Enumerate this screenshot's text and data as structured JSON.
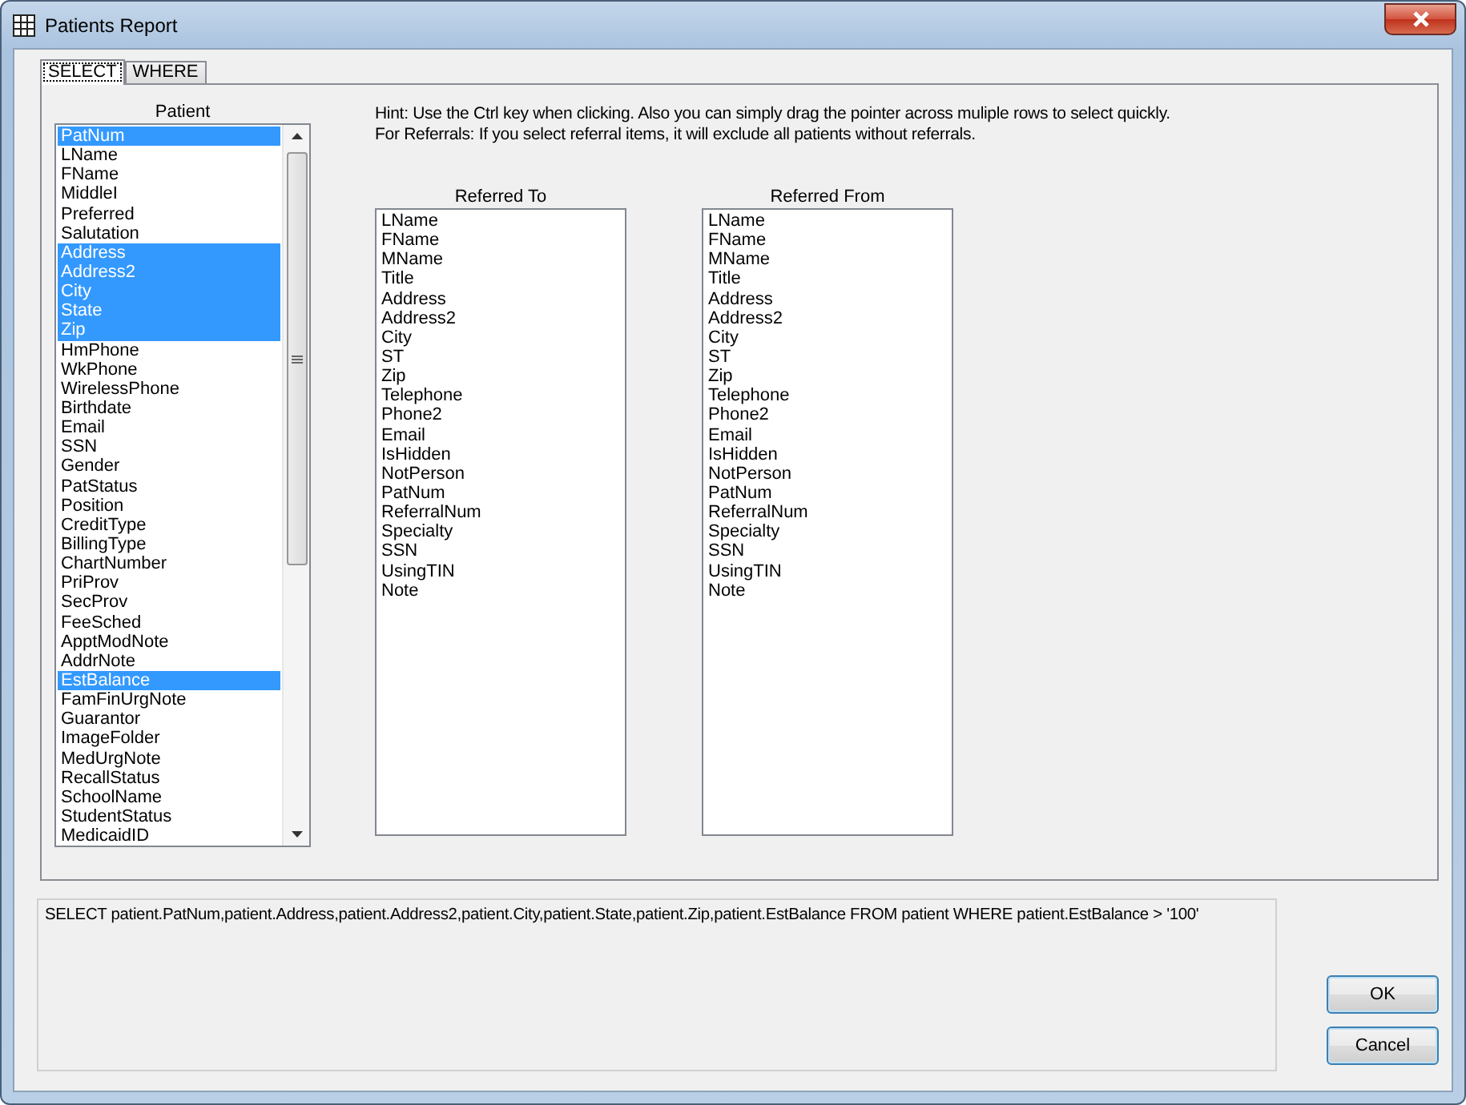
{
  "window": {
    "title": "Patients Report"
  },
  "tabs": [
    {
      "label": "SELECT",
      "selected": true
    },
    {
      "label": "WHERE",
      "selected": false
    }
  ],
  "patient_list": {
    "label": "Patient",
    "items": [
      {
        "text": "PatNum",
        "selected": true
      },
      {
        "text": "LName",
        "selected": false
      },
      {
        "text": "FName",
        "selected": false
      },
      {
        "text": "MiddleI",
        "selected": false
      },
      {
        "text": "Preferred",
        "selected": false
      },
      {
        "text": "Salutation",
        "selected": false
      },
      {
        "text": "Address",
        "selected": true
      },
      {
        "text": "Address2",
        "selected": true
      },
      {
        "text": "City",
        "selected": true
      },
      {
        "text": "State",
        "selected": true
      },
      {
        "text": "Zip",
        "selected": true
      },
      {
        "text": "HmPhone",
        "selected": false
      },
      {
        "text": "WkPhone",
        "selected": false
      },
      {
        "text": "WirelessPhone",
        "selected": false
      },
      {
        "text": "Birthdate",
        "selected": false
      },
      {
        "text": "Email",
        "selected": false
      },
      {
        "text": "SSN",
        "selected": false
      },
      {
        "text": "Gender",
        "selected": false
      },
      {
        "text": "PatStatus",
        "selected": false
      },
      {
        "text": "Position",
        "selected": false
      },
      {
        "text": "CreditType",
        "selected": false
      },
      {
        "text": "BillingType",
        "selected": false
      },
      {
        "text": "ChartNumber",
        "selected": false
      },
      {
        "text": "PriProv",
        "selected": false
      },
      {
        "text": "SecProv",
        "selected": false
      },
      {
        "text": "FeeSched",
        "selected": false
      },
      {
        "text": "ApptModNote",
        "selected": false
      },
      {
        "text": "AddrNote",
        "selected": false
      },
      {
        "text": "EstBalance",
        "selected": true
      },
      {
        "text": "FamFinUrgNote",
        "selected": false
      },
      {
        "text": "Guarantor",
        "selected": false
      },
      {
        "text": "ImageFolder",
        "selected": false
      },
      {
        "text": "MedUrgNote",
        "selected": false
      },
      {
        "text": "RecallStatus",
        "selected": false
      },
      {
        "text": "SchoolName",
        "selected": false
      },
      {
        "text": "StudentStatus",
        "selected": false
      },
      {
        "text": "MedicaidID",
        "selected": false
      }
    ]
  },
  "hint": [
    "Hint: Use the Ctrl key when clicking.  Also you can simply drag the pointer across muliple rows to select quickly.",
    "For Referrals: If you select referral items, it will exclude all patients without referrals."
  ],
  "referral_lists": [
    {
      "label": "Referred To",
      "items": [
        {
          "text": "LName",
          "selected": false
        },
        {
          "text": "FName",
          "selected": false
        },
        {
          "text": "MName",
          "selected": false
        },
        {
          "text": "Title",
          "selected": false
        },
        {
          "text": "Address",
          "selected": false
        },
        {
          "text": "Address2",
          "selected": false
        },
        {
          "text": "City",
          "selected": false
        },
        {
          "text": "ST",
          "selected": false
        },
        {
          "text": "Zip",
          "selected": false
        },
        {
          "text": "Telephone",
          "selected": false
        },
        {
          "text": "Phone2",
          "selected": false
        },
        {
          "text": "Email",
          "selected": false
        },
        {
          "text": "IsHidden",
          "selected": false
        },
        {
          "text": "NotPerson",
          "selected": false
        },
        {
          "text": "PatNum",
          "selected": false
        },
        {
          "text": "ReferralNum",
          "selected": false
        },
        {
          "text": "Specialty",
          "selected": false
        },
        {
          "text": "SSN",
          "selected": false
        },
        {
          "text": "UsingTIN",
          "selected": false
        },
        {
          "text": "Note",
          "selected": false
        }
      ]
    },
    {
      "label": "Referred From",
      "items": [
        {
          "text": "LName",
          "selected": false
        },
        {
          "text": "FName",
          "selected": false
        },
        {
          "text": "MName",
          "selected": false
        },
        {
          "text": "Title",
          "selected": false
        },
        {
          "text": "Address",
          "selected": false
        },
        {
          "text": "Address2",
          "selected": false
        },
        {
          "text": "City",
          "selected": false
        },
        {
          "text": "ST",
          "selected": false
        },
        {
          "text": "Zip",
          "selected": false
        },
        {
          "text": "Telephone",
          "selected": false
        },
        {
          "text": "Phone2",
          "selected": false
        },
        {
          "text": "Email",
          "selected": false
        },
        {
          "text": "IsHidden",
          "selected": false
        },
        {
          "text": "NotPerson",
          "selected": false
        },
        {
          "text": "PatNum",
          "selected": false
        },
        {
          "text": "ReferralNum",
          "selected": false
        },
        {
          "text": "Specialty",
          "selected": false
        },
        {
          "text": "SSN",
          "selected": false
        },
        {
          "text": "UsingTIN",
          "selected": false
        },
        {
          "text": "Note",
          "selected": false
        }
      ]
    }
  ],
  "sql_text": "SELECT patient.PatNum,patient.Address,patient.Address2,patient.City,patient.State,patient.Zip,patient.EstBalance FROM patient WHERE patient.EstBalance > '100'",
  "buttons": [
    {
      "label": "OK"
    },
    {
      "label": "Cancel"
    }
  ]
}
